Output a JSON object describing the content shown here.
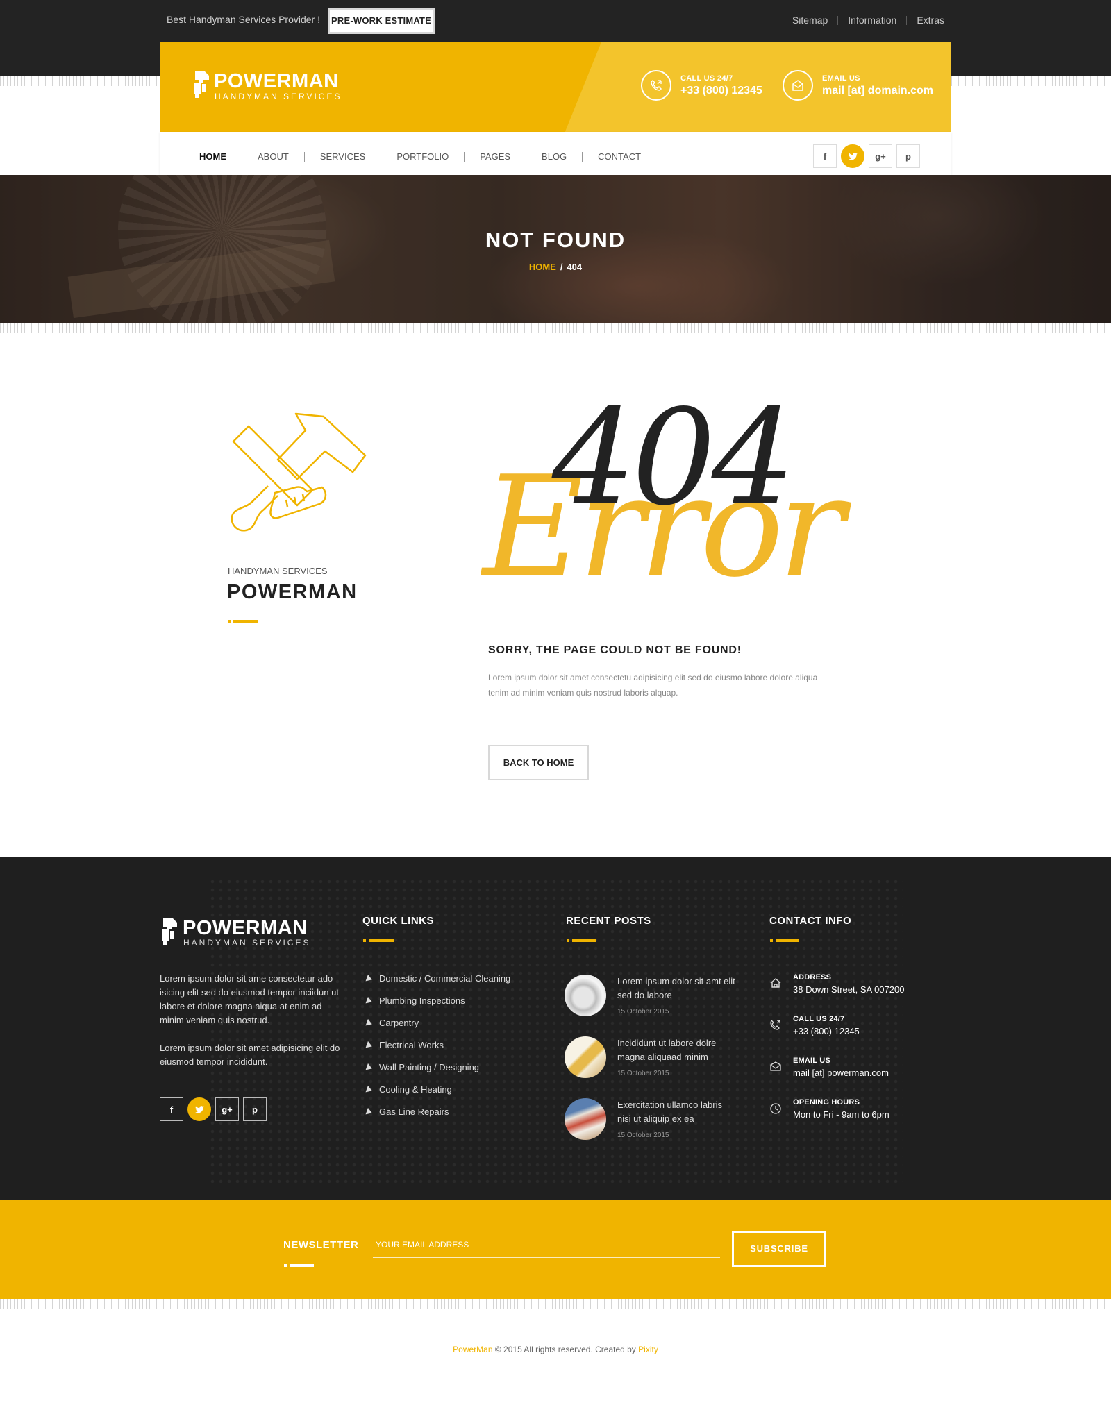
{
  "topbar": {
    "tagline": "Best Handyman Services Provider !",
    "estimate_button": "PRE-WORK ESTIMATE",
    "links": [
      "Sitemap",
      "Information",
      "Extras"
    ]
  },
  "header": {
    "logo_word": "POWERMAN",
    "logo_sub": "HANDYMAN SERVICES",
    "call_label": "CALL US 24/7",
    "call_value": "+33 (800) 12345",
    "email_label": "EMAIL US",
    "email_value": "mail [at] domain.com"
  },
  "nav": {
    "items": [
      "HOME",
      "ABOUT",
      "SERVICES",
      "PORTFOLIO",
      "PAGES",
      "BLOG",
      "CONTACT"
    ],
    "active": "HOME"
  },
  "social_icons": [
    "facebook-icon",
    "twitter-icon",
    "google-plus-icon",
    "pinterest-icon"
  ],
  "hero": {
    "title": "NOT FOUND",
    "crumb_home": "HOME",
    "crumb_sep": "/",
    "crumb_current": "404"
  },
  "content": {
    "brand_small": "HANDYMAN SERVICES",
    "brand_big": "POWERMAN",
    "code": "404",
    "error_word": "Error",
    "heading": "SORRY, THE PAGE COULD NOT BE FOUND!",
    "description": "Lorem ipsum dolor sit amet consectetu adipisicing elit sed do eiusmo labore dolore aliqua tenim ad minim veniam quis nostrud laboris alquap.",
    "back_button": "BACK TO HOME"
  },
  "footer": {
    "logo_word": "POWERMAN",
    "logo_sub": "HANDYMAN SERVICES",
    "about_1": "Lorem ipsum dolor sit ame consectetur ado isicing elit sed do eiusmod tempor inciidun ut labore et dolore magna aiqua at enim ad minim veniam quis nostrud.",
    "about_2": "Lorem ipsum dolor sit amet adipisicing elit do eiusmod tempor incididunt.",
    "quick_links_title": "QUICK LINKS",
    "quick_links": [
      "Domestic / Commercial Cleaning",
      "Plumbing Inspections",
      "Carpentry",
      "Electrical Works",
      "Wall Painting / Designing",
      "Cooling & Heating",
      "Gas Line Repairs"
    ],
    "recent_posts_title": "RECENT POSTS",
    "posts": [
      {
        "title": "Lorem ipsum dolor sit amt elit sed do labore",
        "date": "15 October 2015"
      },
      {
        "title": "Incididunt ut labore dolre magna aliquaad minim",
        "date": "15 October 2015"
      },
      {
        "title": "Exercitation ullamco labris nisi ut aliquip ex ea",
        "date": "15 October 2015"
      }
    ],
    "contact_title": "CONTACT INFO",
    "contact": [
      {
        "icon": "home-icon",
        "label": "ADDRESS",
        "value": "38 Down Street, SA 007200"
      },
      {
        "icon": "phone-icon",
        "label": "CALL US 24/7",
        "value": "+33 (800) 12345"
      },
      {
        "icon": "mail-icon",
        "label": "EMAIL US",
        "value": "mail [at] powerman.com"
      },
      {
        "icon": "clock-icon",
        "label": "OPENING HOURS",
        "value": "Mon to Fri  -  9am to 6pm"
      }
    ]
  },
  "newsletter": {
    "label": "NEWSLETTER",
    "placeholder": "YOUR EMAIL ADDRESS",
    "button": "SUBSCRIBE"
  },
  "copyright": {
    "brand": "PowerMan",
    "text": " © 2015  All rights reserved. Created by ",
    "author": "Pixity"
  },
  "colors": {
    "accent": "#f0b400",
    "dark": "#1f1f1f",
    "topbar": "#232323"
  }
}
